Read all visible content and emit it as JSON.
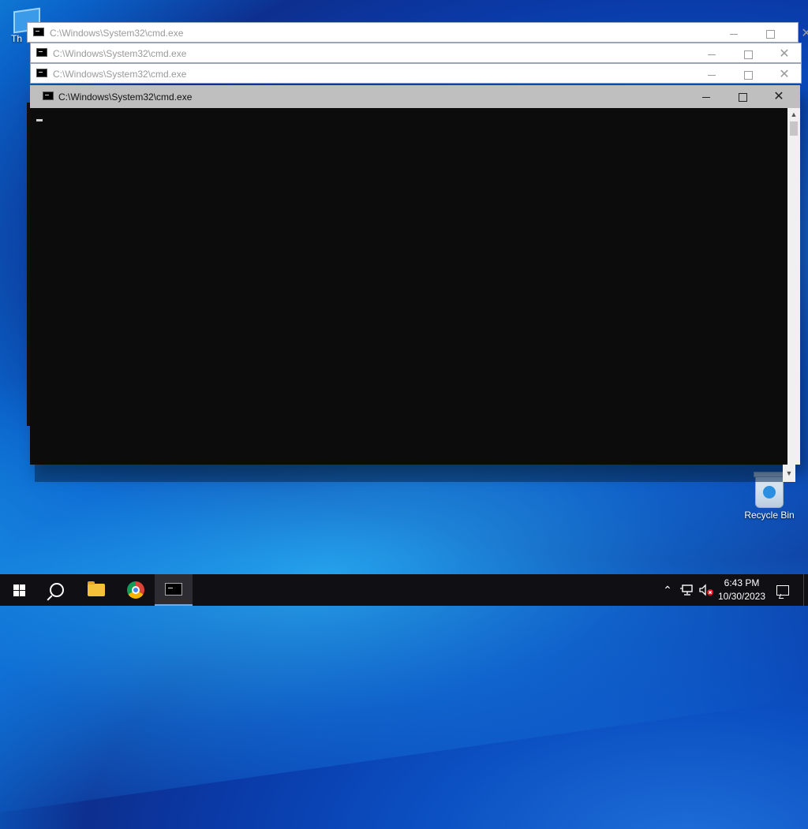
{
  "desktop": {
    "icons": [
      {
        "label": "Th"
      },
      {
        "label": "Recycle Bin"
      }
    ]
  },
  "windows": [
    {
      "title": "C:\\Windows\\System32\\cmd.exe",
      "state": "inactive"
    },
    {
      "title": "C:\\Windows\\System32\\cmd.exe",
      "state": "inactive"
    },
    {
      "title": "C:\\Windows\\System32\\cmd.exe",
      "state": "inactive"
    },
    {
      "title": "C:\\Windows\\System32\\cmd.exe",
      "state": "active"
    }
  ],
  "controls": {
    "minimize": "—",
    "maximize": "☐",
    "close": "✕"
  },
  "taskbar": {
    "apps": [
      "start",
      "search",
      "file-explorer",
      "chrome",
      "cmd"
    ],
    "tray": {
      "chevron": "⌃",
      "time": "6:43 PM",
      "date": "10/30/2023"
    }
  },
  "colors": {
    "console_bg": "#0c0c0c",
    "titlebar_active": "#bfbfbf",
    "taskbar_bg": "#0f0f14"
  }
}
